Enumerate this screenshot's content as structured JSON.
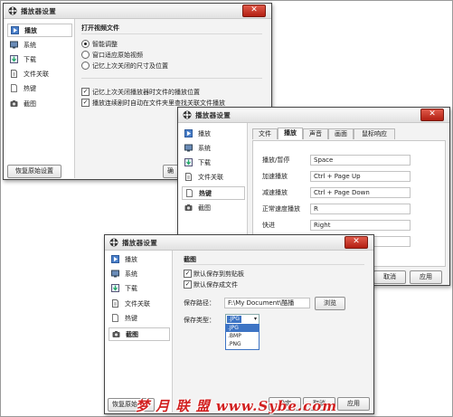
{
  "dialog_title": "播放器设置",
  "sidebar": [
    {
      "label": "播放",
      "icon": "play-icon"
    },
    {
      "label": "系统",
      "icon": "system-icon"
    },
    {
      "label": "下载",
      "icon": "download-icon"
    },
    {
      "label": "文件关联",
      "icon": "file-association-icon"
    },
    {
      "label": "热键",
      "icon": "hotkey-icon"
    },
    {
      "label": "截图",
      "icon": "screenshot-icon"
    }
  ],
  "restore_defaults": "恢复原始设置",
  "window1": {
    "section_title": "打开视频文件",
    "radio_options": [
      "智能调整",
      "窗口适应原始视频",
      "记忆上次关闭的尺寸及位置"
    ],
    "checkboxes": [
      "记忆上次关闭播放器时文件的播放位置",
      "播放连续剧时自动在文件夹里查找关联文件播放"
    ],
    "partial_button": "确"
  },
  "window2": {
    "tabs": [
      "文件",
      "播放",
      "声音",
      "画面",
      "鼠标响应"
    ],
    "hotkeys": [
      {
        "action": "播放/暂停",
        "key": "Space"
      },
      {
        "action": "加速播放",
        "key": "Ctrl + Page Up"
      },
      {
        "action": "减速播放",
        "key": "Ctrl + Page Down"
      },
      {
        "action": "正常速度播放",
        "key": "R"
      },
      {
        "action": "快进",
        "key": "Right"
      },
      {
        "action": "",
        "key": ""
      }
    ],
    "buttons": {
      "cancel": "取消",
      "apply": "应用"
    }
  },
  "window3": {
    "section_title": "截图",
    "checkboxes": [
      "默认保存到剪贴板",
      "默认保存成文件"
    ],
    "save_path_label": "保存路径：",
    "save_path_value": "F:\\My Document\\酷播",
    "browse": "浏览",
    "save_type_label": "保存类型：",
    "save_type_selected": ".JPG",
    "type_options": [
      ".JPG",
      ".BMP",
      ".PNG"
    ],
    "restore_partial": "恢复原始",
    "buttons": {
      "ok": "确定",
      "cancel": "取消",
      "apply": "应用"
    }
  },
  "watermark": "梦 月 联 盟   www.Sybe.com",
  "colors": {
    "close": "#c33324",
    "accent_blue": "#3d74c4",
    "watermark": "#d22020"
  }
}
